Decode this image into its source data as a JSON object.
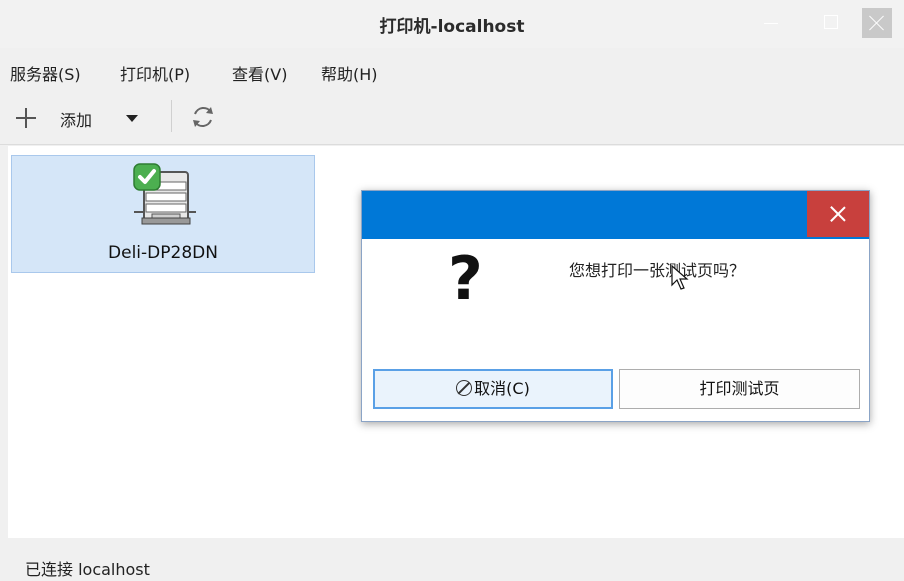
{
  "window": {
    "title": "打印机-localhost"
  },
  "menubar": {
    "items": [
      {
        "label": "服务器(S)"
      },
      {
        "label": "打印机(P)"
      },
      {
        "label": "查看(V)"
      },
      {
        "label": "帮助(H)"
      }
    ]
  },
  "toolbar": {
    "add_label": "添加",
    "add_icon": "plus-icon",
    "dropdown_icon": "chevron-down-icon",
    "refresh_icon": "refresh-icon"
  },
  "printers": [
    {
      "name": "Deli-DP28DN",
      "status_icon": "check-badge-icon",
      "selected": true
    }
  ],
  "statusbar": {
    "text": "已连接 localhost"
  },
  "dialog": {
    "icon": "question-icon",
    "icon_glyph": "?",
    "message": "您想打印一张测试页吗？",
    "cancel_label": "取消(C)",
    "ok_label": "打印测试页",
    "title_color": "#0078d7",
    "close_color": "#c8403d"
  }
}
